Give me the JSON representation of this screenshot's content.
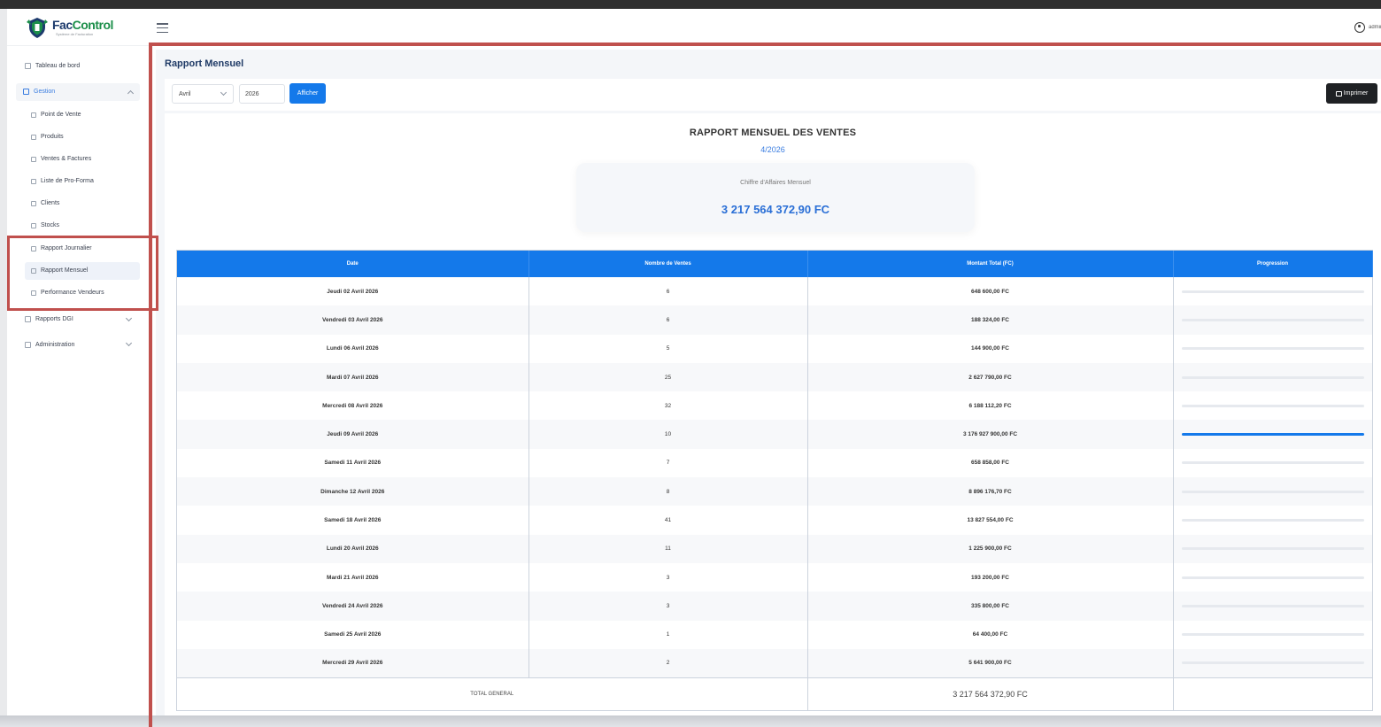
{
  "app": {
    "name_part1": "Fac",
    "name_part2": "Control",
    "tagline": "Système de Facturation",
    "user_name": "admin"
  },
  "sidebar": {
    "dashboard": "Tableau de bord",
    "gestion": "Gestion",
    "sub_items": [
      {
        "label": "Point de Vente",
        "icon": "cart-icon"
      },
      {
        "label": "Produits",
        "icon": "box-icon"
      },
      {
        "label": "Ventes & Factures",
        "icon": "receipt-icon"
      },
      {
        "label": "Liste de Pro-Forma",
        "icon": "document-icon"
      },
      {
        "label": "Clients",
        "icon": "users-icon"
      },
      {
        "label": "Stocks",
        "icon": "warehouse-icon"
      },
      {
        "label": "Rapport Journalier",
        "icon": "chart-line-icon"
      },
      {
        "label": "Rapport Mensuel",
        "icon": "calendar-icon"
      },
      {
        "label": "Performance Vendeurs",
        "icon": "chart-bar-icon"
      }
    ],
    "rapports_dgi": "Rapports DGI",
    "administration": "Administration"
  },
  "page": {
    "title": "Rapport Mensuel"
  },
  "filters": {
    "month": "Avril",
    "year": "2026",
    "show_button": "Afficher",
    "print_button": "Imprimer"
  },
  "report": {
    "title": "RAPPORT MENSUEL DES VENTES",
    "period": "4/2026",
    "ca_label": "Chiffre d'Affaires Mensuel",
    "ca_value": "3 217 564 372,90 FC"
  },
  "table": {
    "headers": [
      "Date",
      "Nombre de Ventes",
      "Montant Total (FC)",
      "Progression"
    ],
    "rows": [
      {
        "date": "Jeudi 02 Avril 2026",
        "count": "6",
        "amount": "648 600,00 FC",
        "progress": 0.0
      },
      {
        "date": "Vendredi 03 Avril 2026",
        "count": "6",
        "amount": "188 324,00 FC",
        "progress": 0.0
      },
      {
        "date": "Lundi 06 Avril 2026",
        "count": "5",
        "amount": "144 900,00 FC",
        "progress": 0.0
      },
      {
        "date": "Mardi 07 Avril 2026",
        "count": "25",
        "amount": "2 627 790,00 FC",
        "progress": 0.0
      },
      {
        "date": "Mercredi 08 Avril 2026",
        "count": "32",
        "amount": "6 188 112,20 FC",
        "progress": 0.0
      },
      {
        "date": "Jeudi 09 Avril 2026",
        "count": "10",
        "amount": "3 176 927 900,00 FC",
        "progress": 1.0
      },
      {
        "date": "Samedi 11 Avril 2026",
        "count": "7",
        "amount": "658 858,00 FC",
        "progress": 0.0
      },
      {
        "date": "Dimanche 12 Avril 2026",
        "count": "8",
        "amount": "8 896 176,70 FC",
        "progress": 0.0
      },
      {
        "date": "Samedi 18 Avril 2026",
        "count": "41",
        "amount": "13 827 554,00 FC",
        "progress": 0.0
      },
      {
        "date": "Lundi 20 Avril 2026",
        "count": "11",
        "amount": "1 225 900,00 FC",
        "progress": 0.0
      },
      {
        "date": "Mardi 21 Avril 2026",
        "count": "3",
        "amount": "193 200,00 FC",
        "progress": 0.0
      },
      {
        "date": "Vendredi 24 Avril 2026",
        "count": "3",
        "amount": "335 800,00 FC",
        "progress": 0.0
      },
      {
        "date": "Samedi 25 Avril 2026",
        "count": "1",
        "amount": "64 400,00 FC",
        "progress": 0.0
      },
      {
        "date": "Mercredi 29 Avril 2026",
        "count": "2",
        "amount": "5 641 900,00 FC",
        "progress": 0.0
      }
    ],
    "total_label": "TOTAL GENERAL",
    "total_amount": "3 217 564 372,90 FC"
  },
  "colors": {
    "primary": "#1479ea",
    "brand_dark": "#1d3b6d",
    "brand_green": "#1c8f4a",
    "highlight_red": "#c0504d",
    "print_button": "#1f2124"
  }
}
